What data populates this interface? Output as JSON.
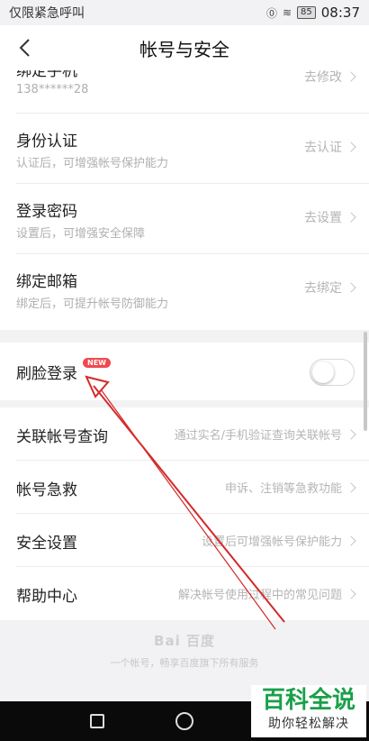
{
  "status_bar": {
    "carrier": "仅限紧急呼叫",
    "battery": "85",
    "time": "08:37"
  },
  "header": {
    "title": "帐号与安全",
    "back_icon": "back-chevron-icon"
  },
  "security_items": [
    {
      "title": "绑定手机",
      "subtitle": "138******28",
      "action": "去修改"
    },
    {
      "title": "身份认证",
      "subtitle": "认证后，可增强帐号保护能力",
      "action": "去认证"
    },
    {
      "title": "登录密码",
      "subtitle": "设置后，可增强安全保障",
      "action": "去设置"
    },
    {
      "title": "绑定邮箱",
      "subtitle": "绑定后，可提升帐号防御能力",
      "action": "去绑定"
    }
  ],
  "face_login": {
    "title": "刷脸登录",
    "badge": "NEW",
    "enabled": false
  },
  "more_items": [
    {
      "title": "关联帐号查询",
      "action": "通过实名/手机验证查询关联帐号"
    },
    {
      "title": "帐号急救",
      "action": "申诉、注销等急救功能"
    },
    {
      "title": "安全设置",
      "action": "设置后可增强帐号保护能力"
    },
    {
      "title": "帮助中心",
      "action": "解决帐号使用过程中的常见问题"
    }
  ],
  "footer": {
    "logo": "Bai 百度",
    "text": "一个帐号，畅享百度旗下所有服务"
  },
  "watermark": {
    "title": "百科全说",
    "subtitle": "助你轻松解决"
  },
  "colors": {
    "badge": "#f0484e",
    "annotation_arrow": "#d42a2a",
    "watermark_green": "#1aa04a"
  }
}
